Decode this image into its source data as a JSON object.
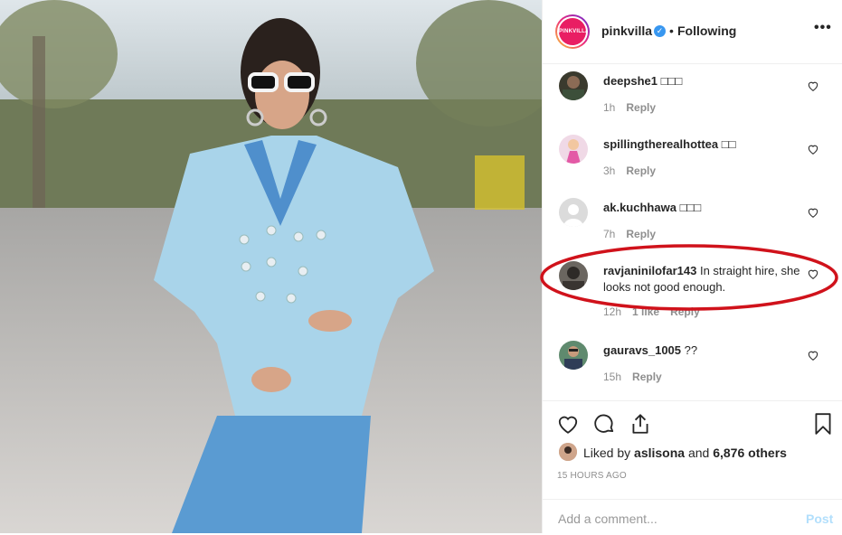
{
  "post": {
    "username": "pinkvilla",
    "avatar_text": "PINKVILLA",
    "verified_icon": "verified-badge-icon",
    "separator": "•",
    "follow_status": "Following",
    "more_label": "•••"
  },
  "comments": [
    {
      "username": "deepshe1",
      "text": "□□□",
      "time": "1h",
      "likes": "",
      "reply": "Reply"
    },
    {
      "username": "spillingtherealhottea",
      "text": "□□",
      "time": "3h",
      "likes": "",
      "reply": "Reply"
    },
    {
      "username": "ak.kuchhawa",
      "text": "□□□",
      "time": "7h",
      "likes": "",
      "reply": "Reply"
    },
    {
      "username": "ravjaninilofar143",
      "text": "In straight hire, she looks not good enough.",
      "time": "12h",
      "likes": "1 like",
      "reply": "Reply"
    },
    {
      "username": "gauravs_1005",
      "text": "??",
      "time": "15h",
      "likes": "",
      "reply": "Reply"
    }
  ],
  "actions": {
    "liked_prefix": "Liked by",
    "liked_user": "aslisona",
    "liked_and": "and",
    "liked_count": "6,876 others",
    "timestamp": "15 HOURS AGO",
    "comment_placeholder": "Add a comment...",
    "post_label": "Post"
  },
  "colors": {
    "accent_blue": "#3897f0",
    "highlight_red": "#d0121b",
    "post_disabled": "#b2dffc"
  }
}
